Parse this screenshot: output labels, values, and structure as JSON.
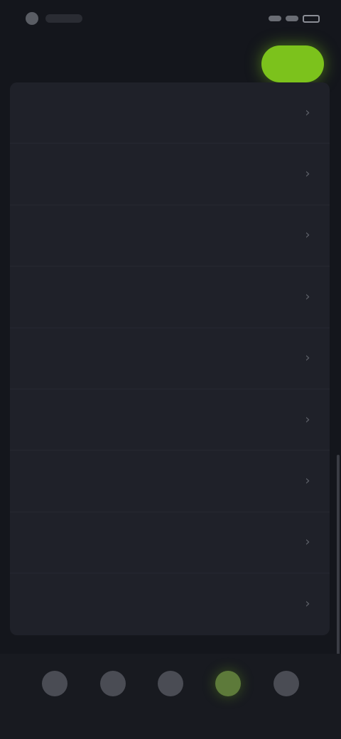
{
  "status_bar": {
    "time": "",
    "carrier": ""
  },
  "header": {
    "left_label": "",
    "center_label": "",
    "button_label": ""
  },
  "list": {
    "items": [
      {
        "label": ""
      },
      {
        "label": ""
      },
      {
        "label": ""
      },
      {
        "label": ""
      },
      {
        "label": ""
      },
      {
        "label": ""
      },
      {
        "label": ""
      },
      {
        "label": ""
      },
      {
        "label": ""
      }
    ]
  },
  "bottom_nav": {
    "items": [
      {
        "label": "",
        "icon": "nav-icon"
      },
      {
        "label": "",
        "icon": "nav-icon"
      },
      {
        "label": "",
        "icon": "nav-icon"
      },
      {
        "label": "",
        "icon": "nav-icon"
      },
      {
        "label": "",
        "icon": "nav-icon"
      }
    ],
    "active_index": 3
  },
  "colors": {
    "background": "#14161c",
    "card": "#1f2129",
    "accent": "#7cc21c",
    "nav_background": "#181a20"
  }
}
